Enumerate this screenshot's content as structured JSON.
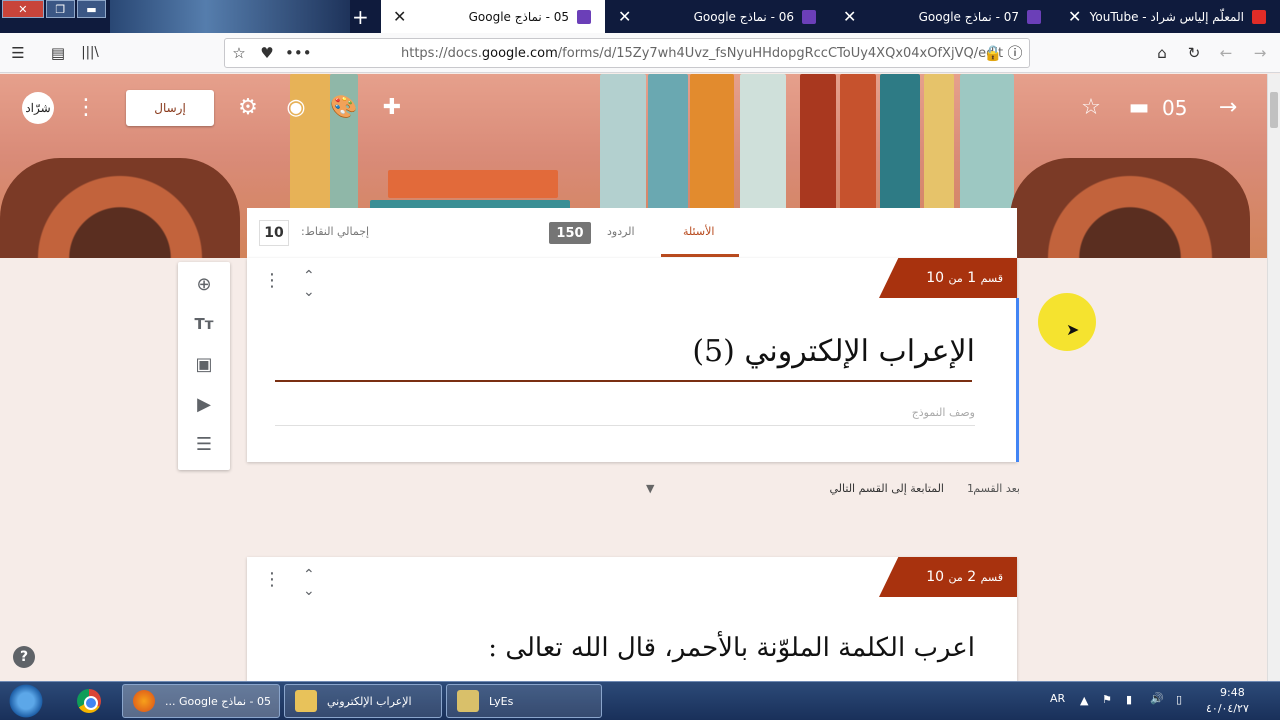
{
  "browser": {
    "tabs": [
      {
        "title": "05 - نماذج Google",
        "active": true,
        "favicon": "forms-icon"
      },
      {
        "title": "06 - نماذج Google",
        "active": false,
        "favicon": "forms-icon"
      },
      {
        "title": "07 - نماذج Google",
        "active": false,
        "favicon": "forms-icon"
      },
      {
        "title": "المعلّم إلياس شراد - YouTube",
        "active": false,
        "favicon": "youtube-icon"
      }
    ],
    "url_prefix": "https://docs.",
    "url_domain": "google.com",
    "url_path": "/forms/d/15Zy7wh4Uvz_fsNyuHHdopgRccCToUy4XQx04xOfXjVQ/edit"
  },
  "form_header": {
    "send_label": "إرسال",
    "form_name": "05",
    "logo_text": "شرّاد"
  },
  "tabs_bar": {
    "questions_label": "الأسئلة",
    "responses_label": "الردود",
    "responses_count": "150",
    "total_points_label": "إجمالي النقاط:",
    "total_points_value": "10"
  },
  "sections": [
    {
      "tag_prefix": "قسم",
      "tag_number": "1",
      "tag_of": "من",
      "tag_total": "10",
      "title": "الإعراب الإلكتروني (5)",
      "description_placeholder": "وصف النموذج"
    },
    {
      "tag_prefix": "قسم",
      "tag_number": "2",
      "tag_of": "من",
      "tag_total": "10",
      "title": "اعرب الكلمة الملوّنة بالأحمر، قال الله تعالى :"
    }
  ],
  "after_section": {
    "label": "بعد القسم",
    "number": "1",
    "choice": "المتابعة إلى القسم التالي"
  },
  "taskbar": {
    "tasks": [
      {
        "label": "05 - نماذج Google ...",
        "active": true
      },
      {
        "label": "الإعراب الإلكتروني",
        "active": false
      },
      {
        "label": "LyEs",
        "active": false
      }
    ],
    "language": "AR",
    "time": "9:48",
    "date": "٤٠/٠٤/٢٧"
  },
  "colors": {
    "accent": "#a8320e",
    "tab_active_accent": "#b84a1e",
    "section_active_bar": "#4285f4"
  }
}
